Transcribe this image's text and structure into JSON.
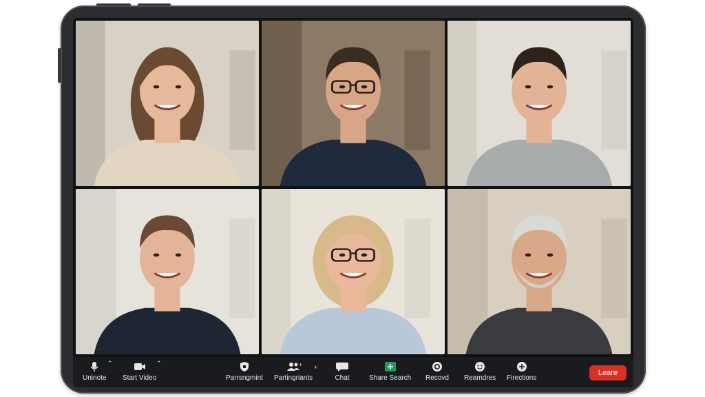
{
  "participants": [
    {
      "id": "p1",
      "bg": "#b9b3a8",
      "wall": "#d7d1c6",
      "skin": "#e6b99a",
      "hair": "#6b4a34",
      "shirt": "#e2d6c3",
      "hair_style": "long"
    },
    {
      "id": "p2",
      "bg": "#6b5a48",
      "wall": "#8c7a66",
      "skin": "#d8a586",
      "hair": "#3b2c22",
      "shirt": "#1f2a3d",
      "hair_style": "short",
      "glasses": true
    },
    {
      "id": "p3",
      "bg": "#cfcac1",
      "wall": "#e3ded5",
      "skin": "#e2b395",
      "hair": "#2e231c",
      "shirt": "#a9acad",
      "hair_style": "short"
    },
    {
      "id": "p4",
      "bg": "#d3d0c9",
      "wall": "#e6e3dc",
      "skin": "#e3b497",
      "hair": "#6a4a33",
      "shirt": "#1f2633",
      "hair_style": "short"
    },
    {
      "id": "p5",
      "bg": "#d7d2c8",
      "wall": "#e9e4da",
      "skin": "#eab99c",
      "hair": "#d8b98a",
      "shirt": "#b8c8d8",
      "hair_style": "bob",
      "glasses": true
    },
    {
      "id": "p6",
      "bg": "#c2b8aa",
      "wall": "#d9cfc1",
      "skin": "#d9a888",
      "hair": "#d9d9d6",
      "shirt": "#3a3b3e",
      "hair_style": "short",
      "beard": "#cfcfcc"
    }
  ],
  "toolbar": {
    "items": [
      {
        "key": "mute",
        "label": "Uninote",
        "icon": "microphone-icon",
        "caret": true
      },
      {
        "key": "video",
        "label": "Start Video",
        "icon": "video-camera-icon",
        "caret": true
      },
      {
        "key": "security",
        "label": "Parrsngmint",
        "icon": "shield-icon",
        "caret": false
      },
      {
        "key": "participants",
        "label": "Partingriants",
        "icon": "people-icon",
        "caret": true
      },
      {
        "key": "chat",
        "label": "Chat",
        "icon": "chat-bubble-icon",
        "caret": false
      },
      {
        "key": "share",
        "label": "Share Search",
        "icon": "share-screen-icon",
        "caret": false
      },
      {
        "key": "record",
        "label": "Recovd",
        "icon": "record-icon",
        "caret": false
      },
      {
        "key": "reactions",
        "label": "Reamdres",
        "icon": "smiley-icon",
        "caret": false
      },
      {
        "key": "functions",
        "label": "Firections",
        "icon": "apps-icon",
        "caret": false
      }
    ],
    "leave_label": "Leare",
    "leave_color": "#d93025",
    "share_color": "#1f9d55"
  }
}
